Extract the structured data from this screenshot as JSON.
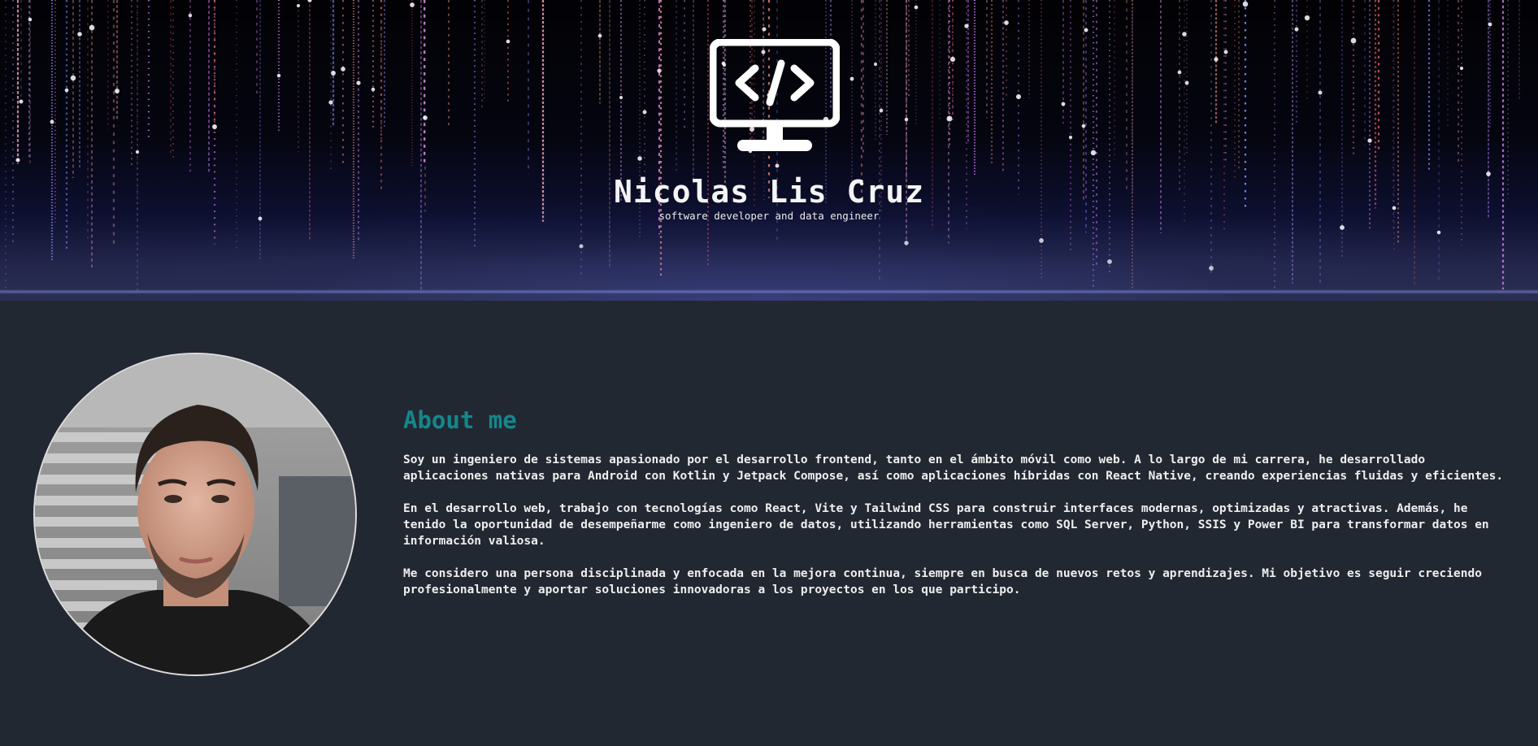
{
  "header": {
    "logo_icon": "monitor-code-icon",
    "name": "Nicolas Lis Cruz",
    "subtitle": "software developer and data engineer"
  },
  "profile": {
    "photo": "profile-photo"
  },
  "about": {
    "title": "About me",
    "paragraphs": [
      "Soy un ingeniero de sistemas apasionado por el desarrollo frontend, tanto en el ámbito móvil como web. A lo largo de mi carrera, he desarrollado aplicaciones nativas para Android con Kotlin y Jetpack Compose, así como aplicaciones híbridas con React Native, creando experiencias fluidas y eficientes.",
      "En el desarrollo web, trabajo con tecnologías como React, Vite y Tailwind CSS para construir interfaces modernas, optimizadas y atractivas. Además, he tenido la oportunidad de desempeñarme como ingeniero de datos, utilizando herramientas como SQL Server, Python, SSIS y Power BI para transformar datos en información valiosa.",
      "Me considero una persona disciplinada y enfocada en la mejora continua, siempre en busca de nuevos retos y aprendizajes. Mi objetivo es seguir creciendo profesionalmente y aportar soluciones innovadoras a los proyectos en los que participo."
    ]
  },
  "colors": {
    "background": "#222831",
    "accent": "#14878c",
    "text": "#eeeeee"
  }
}
